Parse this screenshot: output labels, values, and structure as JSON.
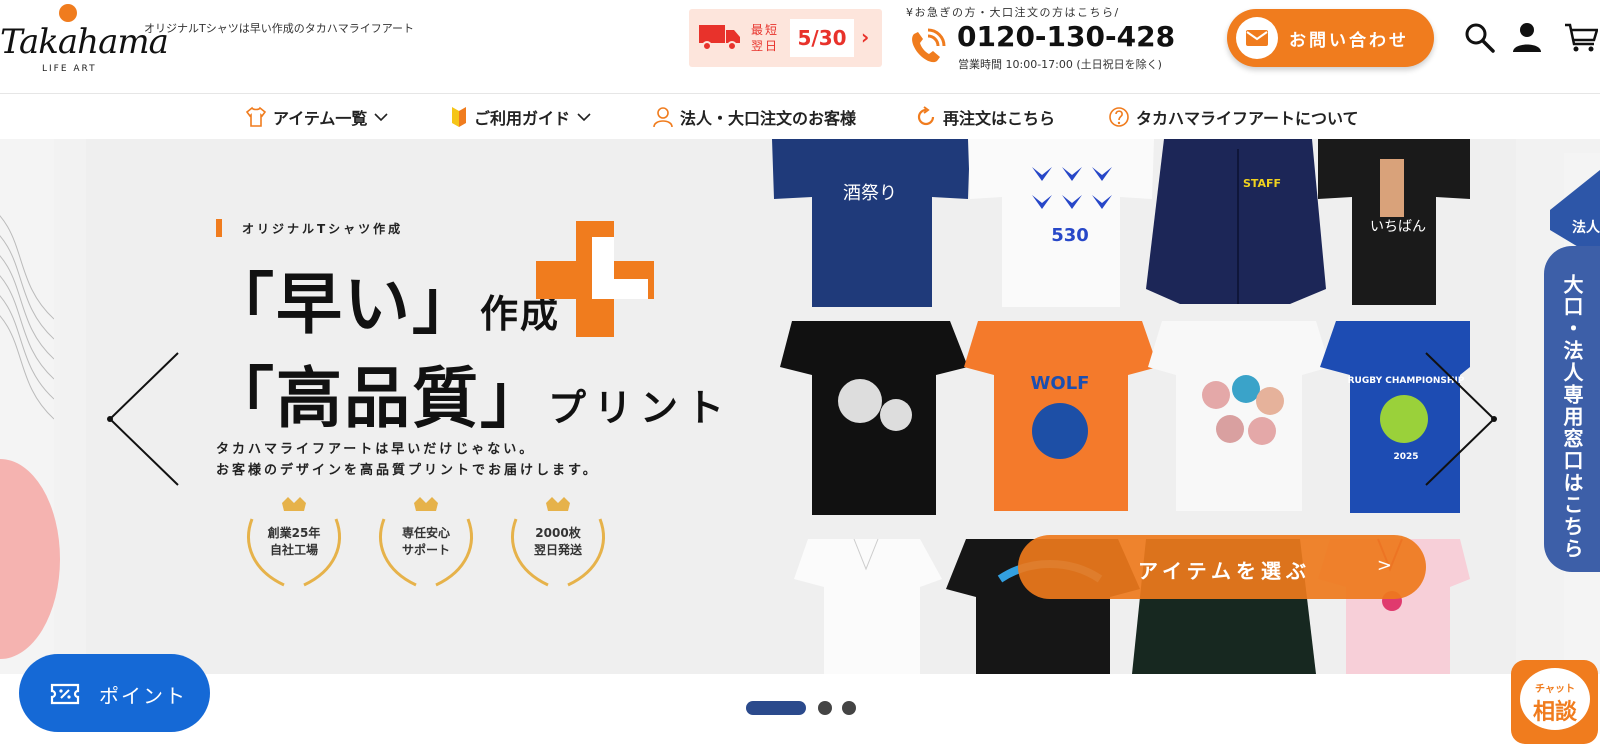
{
  "header": {
    "logo_text": "Takahama",
    "logo_sub": "LIFE ART",
    "tagline": "オリジナルTシャツは早い作成のタカハマライフアート",
    "shipping": {
      "label": "最短翌日",
      "date": "5/30",
      "arrow": "›"
    },
    "phone_note": "¥お急ぎの方・大口注文の方はこちら/",
    "phone_number": "0120-130-428",
    "phone_hours": "営業時間 10:00-17:00 (土日祝日を除く)",
    "contact_label": "お問い合わせ",
    "accent_color": "#f07c1e"
  },
  "nav": {
    "items": [
      {
        "label": "アイテム一覧",
        "icon": "tshirt-icon",
        "dropdown": true
      },
      {
        "label": "ご利用ガイド",
        "icon": "beginner-icon",
        "dropdown": true
      },
      {
        "label": "法人・大口注文のお客様",
        "icon": "person-icon",
        "dropdown": false
      },
      {
        "label": "再注文はこちら",
        "icon": "reorder-icon",
        "dropdown": false
      },
      {
        "label": "タカハマライフアートについて",
        "icon": "question-icon",
        "dropdown": false
      }
    ]
  },
  "hero": {
    "subtitle": "オリジナルTシャツ作成",
    "line1_big": "「早い」",
    "line1_small": "作成",
    "line2_big": "「高品質」",
    "line2_small": "プリント",
    "desc_line1": "タカハマライフアートは早いだけじゃない。",
    "desc_line2": "お客様のデザインを高品質プリントでお届けします。",
    "badges": [
      {
        "line1": "創業25年",
        "line2": "自社工場"
      },
      {
        "line1": "専任安心",
        "line2": "サポート"
      },
      {
        "line1": "2000枚",
        "line2": "翌日発送"
      }
    ],
    "cta_label": "アイテムを選ぶ",
    "cta_arrow": ">",
    "shirt_prints": {
      "sake": "酒祭り",
      "birds": "530",
      "staff": "STAFF",
      "yakitori": "いちばん",
      "wolf": "WOLF",
      "rugby": "RUGBY CHAMPIONSHIP",
      "rugby_year": "2025"
    }
  },
  "side_tab": {
    "label": "大口・法人専用窓口はこちら",
    "ribbon": "法人"
  },
  "point_button": {
    "label": "ポイント"
  },
  "slider": {
    "active_index": 0,
    "count": 3
  },
  "chat": {
    "small": "チャット",
    "big": "相談"
  },
  "colors": {
    "orange": "#f07c1e",
    "blue": "#1569d6",
    "navy": "#3d5fa8",
    "red": "#e8322b"
  }
}
